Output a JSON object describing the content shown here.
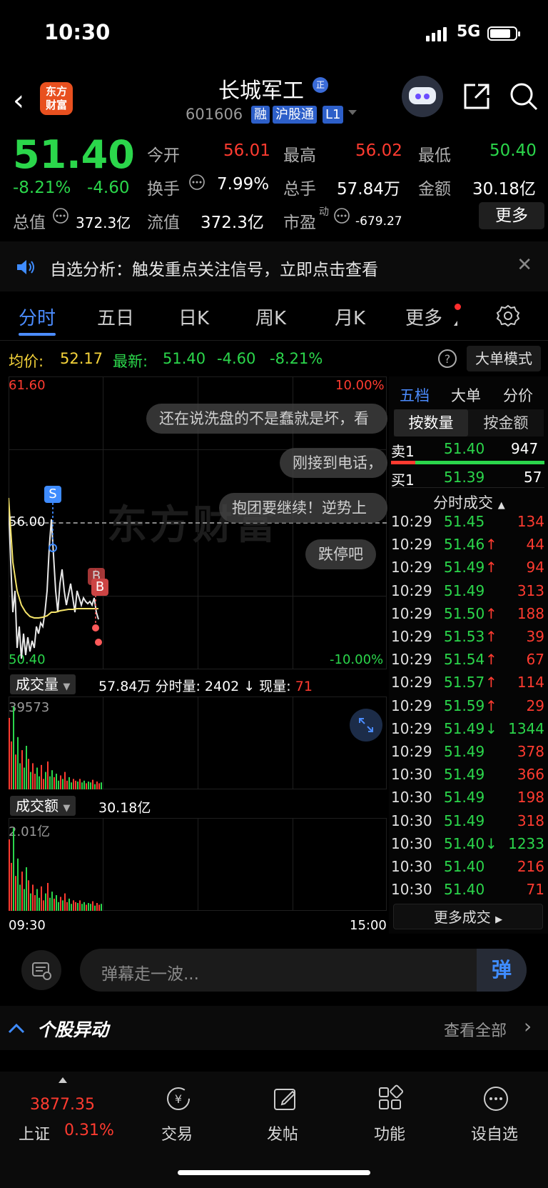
{
  "status": {
    "time": "10:30",
    "network": "5G"
  },
  "header": {
    "logo_line1": "东方",
    "logo_line2": "财富",
    "title": "长城军工",
    "title_badge": "正",
    "code": "601606",
    "tags": [
      "融",
      "沪股通",
      "L1"
    ]
  },
  "quote": {
    "price": "51.40",
    "change_pct": "-8.21%",
    "change": "-4.60",
    "open_label": "今开",
    "open": "56.01",
    "high_label": "最高",
    "high": "56.02",
    "low_label": "最低",
    "low": "50.40",
    "turnover_label": "换手",
    "turnover": "7.99%",
    "volume_label": "总手",
    "volume": "57.84万",
    "amount_label": "金额",
    "amount": "30.18亿",
    "mktcap_label": "总值",
    "mktcap": "372.3亿",
    "float_label": "流值",
    "float": "372.3亿",
    "pe_label": "市盈",
    "pe_sup": "动",
    "pe": "-679.27",
    "more": "更多"
  },
  "notice": {
    "text": "自选分析：触发重点关注信号，立即点击查看"
  },
  "tabs": [
    "分时",
    "五日",
    "日K",
    "周K",
    "月K",
    "更多"
  ],
  "info": {
    "avg_label": "均价:",
    "avg": "52.17",
    "last_label": "最新:",
    "last": "51.40",
    "change": "-4.60",
    "change_pct": "-8.21%",
    "mode": "大单模式"
  },
  "chart": {
    "top_price": "61.60",
    "top_pct": "10.00%",
    "mid_price": "56.00",
    "bottom_price": "50.40",
    "bottom_pct": "-10.00%",
    "marker_s": "S",
    "marker_b": "B",
    "watermark": "东方财富",
    "start_time": "09:30",
    "end_time": "15:00"
  },
  "danmu": [
    "还在说洗盘的不是蠢就是坏，看",
    "刚接到电话，",
    "抱团要继续！逆势上",
    "跌停吧"
  ],
  "volume_panel": {
    "title": "成交量",
    "total": "57.84万",
    "minute_label": "分时量:",
    "minute_vol": "2402",
    "arrow": "↓",
    "current_label": "现量:",
    "current": "71",
    "max": "39573"
  },
  "amount_panel": {
    "title": "成交额",
    "total": "30.18亿",
    "max": "2.01亿"
  },
  "right_panel": {
    "tabs": [
      "五档",
      "大单",
      "分价"
    ],
    "seg_on": "按数量",
    "seg_off": "按金额",
    "ask_label": "卖1",
    "ask_price": "51.40",
    "ask_qty": "947",
    "bid_label": "买1",
    "bid_price": "51.39",
    "bid_qty": "57",
    "trades_title": "分时成交",
    "trades": [
      {
        "t": "10:29",
        "p": "51.45",
        "d": "",
        "q": "134",
        "pc": "green",
        "qc": "red"
      },
      {
        "t": "10:29",
        "p": "51.46",
        "d": "↑",
        "q": "44",
        "pc": "green",
        "qc": "red"
      },
      {
        "t": "10:29",
        "p": "51.49",
        "d": "↑",
        "q": "94",
        "pc": "green",
        "qc": "red"
      },
      {
        "t": "10:29",
        "p": "51.49",
        "d": "",
        "q": "313",
        "pc": "green",
        "qc": "red"
      },
      {
        "t": "10:29",
        "p": "51.50",
        "d": "↑",
        "q": "188",
        "pc": "green",
        "qc": "red"
      },
      {
        "t": "10:29",
        "p": "51.53",
        "d": "↑",
        "q": "39",
        "pc": "green",
        "qc": "red"
      },
      {
        "t": "10:29",
        "p": "51.54",
        "d": "↑",
        "q": "67",
        "pc": "green",
        "qc": "red"
      },
      {
        "t": "10:29",
        "p": "51.57",
        "d": "↑",
        "q": "114",
        "pc": "green",
        "qc": "red"
      },
      {
        "t": "10:29",
        "p": "51.59",
        "d": "↑",
        "q": "29",
        "pc": "green",
        "qc": "red"
      },
      {
        "t": "10:29",
        "p": "51.49",
        "d": "↓",
        "q": "1344",
        "pc": "green",
        "qc": "green"
      },
      {
        "t": "10:29",
        "p": "51.49",
        "d": "",
        "q": "378",
        "pc": "green",
        "qc": "red"
      },
      {
        "t": "10:30",
        "p": "51.49",
        "d": "",
        "q": "366",
        "pc": "green",
        "qc": "red"
      },
      {
        "t": "10:30",
        "p": "51.49",
        "d": "",
        "q": "198",
        "pc": "green",
        "qc": "red"
      },
      {
        "t": "10:30",
        "p": "51.49",
        "d": "",
        "q": "318",
        "pc": "green",
        "qc": "red"
      },
      {
        "t": "10:30",
        "p": "51.40",
        "d": "↓",
        "q": "1233",
        "pc": "green",
        "qc": "green"
      },
      {
        "t": "10:30",
        "p": "51.40",
        "d": "",
        "q": "216",
        "pc": "green",
        "qc": "red"
      },
      {
        "t": "10:30",
        "p": "51.40",
        "d": "",
        "q": "71",
        "pc": "green",
        "qc": "red"
      }
    ],
    "more_deals": "更多成交"
  },
  "bottom": {
    "danmu_placeholder": "弹幕走一波...",
    "danmu_send": "弹",
    "abnormal_title": "个股异动",
    "view_all": "查看全部"
  },
  "nav": {
    "index_value": "3877.35",
    "index_name": "上证",
    "index_pct": "0.31%",
    "items": [
      "交易",
      "发帖",
      "功能",
      "设自选"
    ]
  },
  "colors": {
    "up": "#ff3b30",
    "down": "#2bd64b",
    "accent": "#4b8cff",
    "avg_line": "#f5e46a"
  }
}
